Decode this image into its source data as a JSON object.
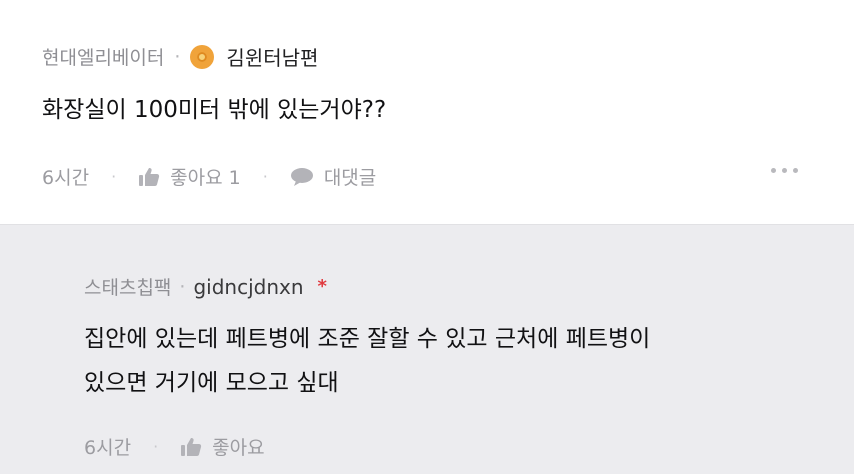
{
  "comment": {
    "company": "현대엘리베이터",
    "separator": "·",
    "nickname": "김윈터남편",
    "text": "화장실이 100미터 밖에 있는거야??",
    "time": "6시간",
    "like_label": "좋아요 1",
    "reply_label": "대댓글",
    "more_icon": "more-dots-icon"
  },
  "reply": {
    "company": "스태츠칩팩",
    "separator": "·",
    "nickname": "gidncjdnxn",
    "author_mark": "*",
    "text_line1": "집안에 있는데 페트병에 조준 잘할 수 있고 근처에 페트병이",
    "text_line2": "있으면 거기에 모으고 싶대",
    "time": "6시간",
    "like_label": "좋아요"
  },
  "colors": {
    "reply_background": "#ececef",
    "author_mark": "#e0393e",
    "badge": "#f0a33a"
  }
}
